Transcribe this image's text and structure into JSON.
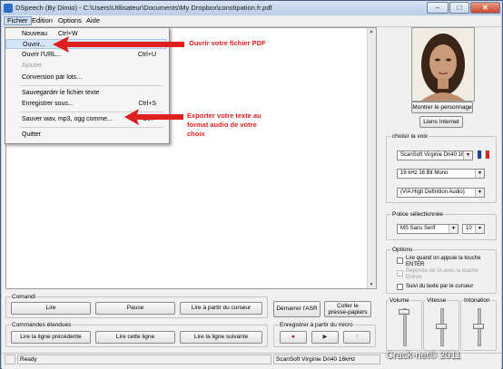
{
  "window": {
    "title": "DSpeech (By Dimio) - C:\\Users\\Utilisateur\\Documents\\My Dropbox\\constipation.fr.pdf",
    "minimize": "–",
    "maximize": "□",
    "close": "✕"
  },
  "menubar": {
    "items": [
      "Fichier",
      "Edition",
      "Options",
      "Aide"
    ]
  },
  "file_menu": {
    "items": [
      {
        "label": "Nouveau",
        "shortcut": "Ctrl+W",
        "disabled": false
      },
      {
        "label": "Ouvrir...",
        "shortcut": "",
        "disabled": false
      },
      {
        "label": "Ouvrir l'URL...",
        "shortcut": "Ctrl+U",
        "disabled": false
      },
      {
        "label": "Ajouter",
        "shortcut": "",
        "disabled": true
      },
      {
        "label": "Conversion par lots...",
        "shortcut": "",
        "disabled": false
      },
      {
        "label": "Sauvegarder le fichier texte",
        "shortcut": "",
        "disabled": false
      },
      {
        "label": "Enregistrer sous...",
        "shortcut": "Ctrl+S",
        "disabled": false
      },
      {
        "label": "Sauver wav, mp3, ogg comme...",
        "shortcut": "Ctrl+",
        "disabled": false
      },
      {
        "label": "Quitter",
        "shortcut": "",
        "disabled": false
      }
    ]
  },
  "annotations": {
    "open_pdf": "Ouvrir votre fichier PDF",
    "export_line1": "Exporter votre texte au",
    "export_line2": "format audio de votre",
    "export_line3": "choix",
    "color": "#e02020"
  },
  "right_panel": {
    "show_character": "Montrer le personnage",
    "internet_links": "Liens Internet",
    "voice_group": "choisir la voix",
    "voice": "ScanSoft Virginie Dri40 16",
    "audio_format": "16 kHz 16 Bit Mono",
    "engine": "(VIA High Definition Audio)",
    "font_group": "Police sélectionnée",
    "font_name": "MS Sans Serif",
    "font_size": "10",
    "options_group": "Options",
    "option1_line1": "Lire quand on appuie la touche",
    "option1_line2": "ENTER",
    "option2_line1": "Réponse de IA avec la touche",
    "option2_line2": "Entrée",
    "option3": "Suivi du texte par le curseur",
    "volume": "Volume",
    "speed": "Vitesse",
    "intonation": "Intonation"
  },
  "commands": {
    "group": "Comandi",
    "read": "Lire",
    "pause": "Pause",
    "read_from_cursor": "Lire à partir du curseur",
    "start_asr": "Démarrer l'ASR",
    "paste_line1": "Coller le",
    "paste_line2": "presse-papiers"
  },
  "extended": {
    "group": "Commandes étendues",
    "read_previous": "Lire la ligne précédente",
    "read_line": "Lire cette ligne",
    "read_next": "Lire la ligne suivante"
  },
  "mic": {
    "group": "Enregistrer à partir du micro",
    "record": "●",
    "play": "▶",
    "add": "+"
  },
  "status": {
    "state": "Ready",
    "voice": "ScanSoft Virginie Dri40 16kHz"
  },
  "watermark": "Crack-net© 2011"
}
